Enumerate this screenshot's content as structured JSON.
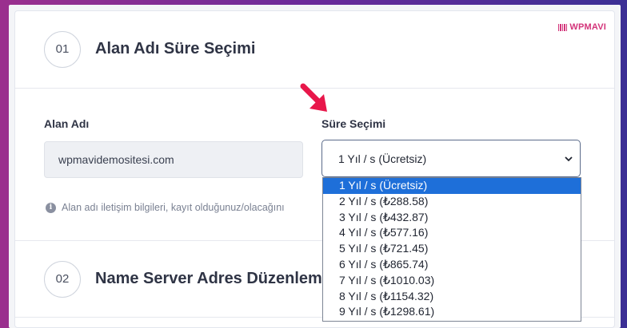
{
  "brand": {
    "name": "WPMAVI"
  },
  "section1": {
    "number": "01",
    "title": "Alan Adı Süre Seçimi"
  },
  "fields": {
    "domain_label": "Alan Adı",
    "domain_value": "wpmavidemositesi.com",
    "duration_label": "Süre Seçimi",
    "duration_selected": "1 Yıl / s (Ücretsiz)"
  },
  "info_text": "Alan adı iletişim bilgileri, kayıt olduğunuz/olacağını",
  "section2": {
    "number": "02",
    "title": "Name Server Adres Düzenleme"
  },
  "dropdown_options": [
    "1 Yıl / s (Ücretsiz)",
    "2 Yıl / s (₺288.58)",
    "3 Yıl / s (₺432.87)",
    "4 Yıl / s (₺577.16)",
    "5 Yıl / s (₺721.45)",
    "6 Yıl / s (₺865.74)",
    "7 Yıl / s (₺1010.03)",
    "8 Yıl / s (₺1154.32)",
    "9 Yıl / s (₺1298.61)"
  ],
  "colors": {
    "accent": "#1e6fd9",
    "arrow": "#e8174a",
    "brand": "#d3347a"
  }
}
